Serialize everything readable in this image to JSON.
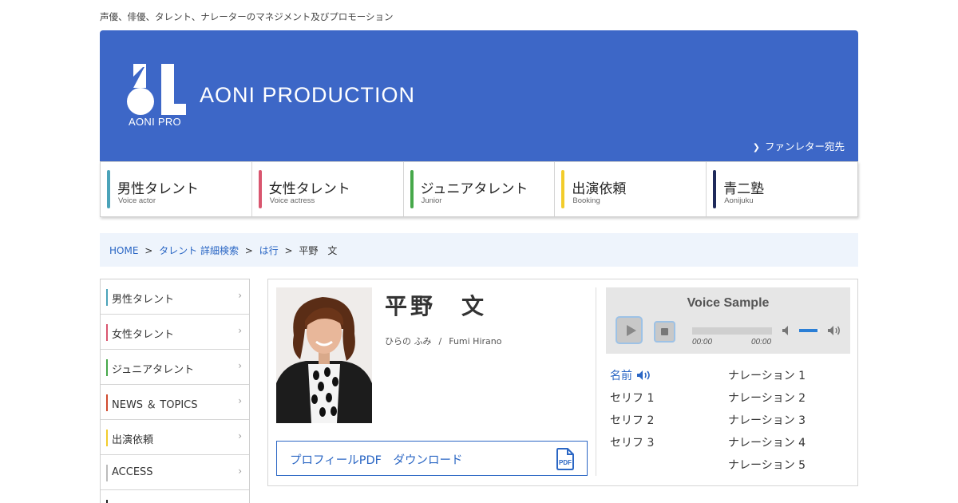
{
  "tagline": "声優、俳優、タレント、ナレーターのマネジメント及びプロモーション",
  "header": {
    "logo_small": "AONI PRO",
    "brand": "AONI PRODUCTION",
    "fanletter": "ファンレター宛先",
    "accent": "#3d67c7"
  },
  "gnav": [
    {
      "title": "男性タレント",
      "sub": "Voice actor",
      "color": "#4ba3b9"
    },
    {
      "title": "女性タレント",
      "sub": "Voice actress",
      "color": "#d9566f"
    },
    {
      "title": "ジュニアタレント",
      "sub": "Junior",
      "color": "#46a84a"
    },
    {
      "title": "出演依頼",
      "sub": "Booking",
      "color": "#f2cc2b"
    },
    {
      "title": "青二塾",
      "sub": "Aonijuku",
      "color": "#1f2a5b"
    }
  ],
  "breadcrumb": {
    "home": "HOME",
    "sep": ">",
    "search": "タレント 詳細検索",
    "row": "は行",
    "current": "平野　文"
  },
  "sidemenu": [
    {
      "label": "男性タレント",
      "color": "#4ba3b9"
    },
    {
      "label": "女性タレント",
      "color": "#d9566f"
    },
    {
      "label": "ジュニアタレント",
      "color": "#46a84a"
    },
    {
      "label": "NEWS ＆ TOPICS",
      "color": "#d04a2e"
    },
    {
      "label": "出演依頼",
      "color": "#f2cc2b"
    },
    {
      "label": "ACCESS",
      "color": "#bbbbbb"
    },
    {
      "label": "",
      "color": "#222222"
    }
  ],
  "profile": {
    "name": "平野　文",
    "reading_kana": "ひらの ふみ",
    "reading_sep": "/",
    "reading_roman": "Fumi Hirano",
    "pdf_label": "プロフィールPDF　ダウンロード"
  },
  "player": {
    "title": "Voice Sample",
    "time_current": "00:00",
    "time_duration": "00:00",
    "volume": 0.9
  },
  "tracks_left": [
    "名前",
    "セリフ 1",
    "セリフ 2",
    "セリフ 3"
  ],
  "tracks_right": [
    "ナレーション 1",
    "ナレーション 2",
    "ナレーション 3",
    "ナレーション 4",
    "ナレーション 5"
  ],
  "icons": {
    "pdf": "pdf-file-icon",
    "speaker": "speaker-icon",
    "chevron": "chevron-right-icon"
  }
}
